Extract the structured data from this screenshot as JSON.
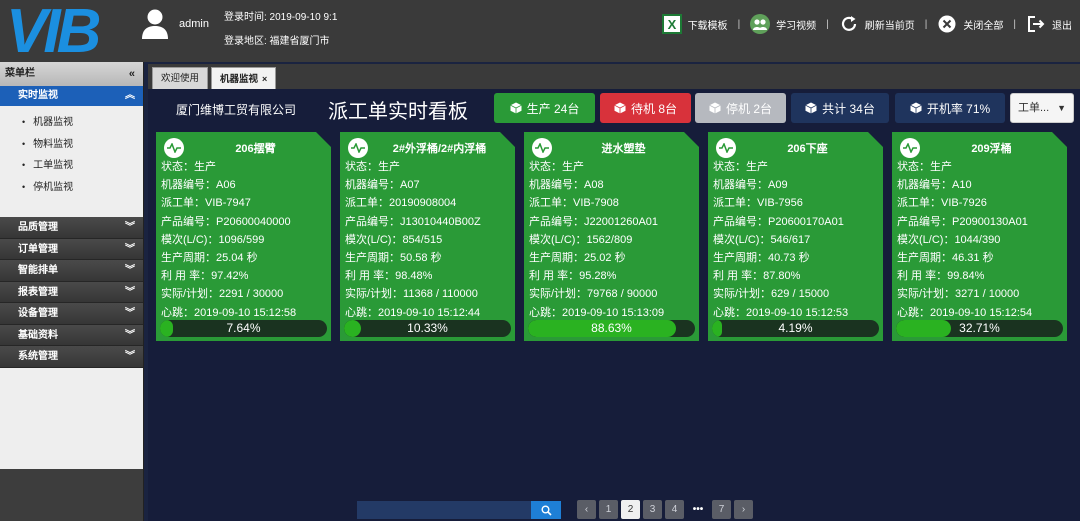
{
  "header": {
    "logo_text": "VIB",
    "username": "admin",
    "login_time": "登录时间: 2019-09-10 9:1",
    "login_region": "登录地区: 福建省厦门市",
    "tools": [
      {
        "label": "下载模板",
        "icon": "excel-icon"
      },
      {
        "label": "学习视频",
        "icon": "users-icon"
      },
      {
        "label": "刷新当前页",
        "icon": "refresh-icon"
      },
      {
        "label": "关闭全部",
        "icon": "close-circle-icon"
      },
      {
        "label": "退出",
        "icon": "logout-icon"
      }
    ]
  },
  "sidebar": {
    "title": "菜单栏",
    "active_group": "实时监视",
    "sub_items": [
      "机器监视",
      "物料监视",
      "工单监视",
      "停机监视"
    ],
    "groups": [
      "品质管理",
      "订单管理",
      "智能排单",
      "报表管理",
      "设备管理",
      "基础资料",
      "系统管理"
    ]
  },
  "tabs": [
    {
      "label": "欢迎使用",
      "active": false
    },
    {
      "label": "机器监视",
      "active": true
    }
  ],
  "board": {
    "company": "厦门维博工贸有限公司",
    "title": "派工单实时看板",
    "stats": {
      "production": "生产 24台",
      "waiting": "待机 8台",
      "stopped": "停机 2台",
      "total": "共计 34台",
      "rate": "开机率 71%"
    },
    "select_value": "工单..."
  },
  "cards": [
    {
      "title": "206摆臂",
      "status": "状态：生产",
      "machine": "机器编号：A06",
      "order": "派工单：VIB-7947",
      "product": "产品编号：P20600040000",
      "mold": "模次(L/C)：1096/599",
      "cycle": "生产周期：25.04 秒",
      "util": "利 用 率：97.42%",
      "plan": "实际/计划：2291 / 30000",
      "heartbeat": "心跳：2019-09-10 15:12:58",
      "progress": 7.64,
      "progress_label": "7.64%"
    },
    {
      "title": "2#外浮桶/2#内浮桶",
      "status": "状态：生产",
      "machine": "机器编号：A07",
      "order": "派工单：20190908004",
      "product": "产品编号：J13010440B00Z",
      "mold": "模次(L/C)：854/515",
      "cycle": "生产周期：50.58 秒",
      "util": "利 用 率：98.48%",
      "plan": "实际/计划：11368 / 110000",
      "heartbeat": "心跳：2019-09-10 15:12:44",
      "progress": 10.33,
      "progress_label": "10.33%"
    },
    {
      "title": "进水塑垫",
      "status": "状态：生产",
      "machine": "机器编号：A08",
      "order": "派工单：VIB-7908",
      "product": "产品编号：J22001260A01",
      "mold": "模次(L/C)：1562/809",
      "cycle": "生产周期：25.02 秒",
      "util": "利 用 率：95.28%",
      "plan": "实际/计划：79768 / 90000",
      "heartbeat": "心跳：2019-09-10 15:13:09",
      "progress": 88.63,
      "progress_label": "88.63%"
    },
    {
      "title": "206下座",
      "status": "状态：生产",
      "machine": "机器编号：A09",
      "order": "派工单：VIB-7956",
      "product": "产品编号：P20600170A01",
      "mold": "模次(L/C)：546/617",
      "cycle": "生产周期：40.73 秒",
      "util": "利 用 率：87.80%",
      "plan": "实际/计划：629 / 15000",
      "heartbeat": "心跳：2019-09-10 15:12:53",
      "progress": 4.19,
      "progress_label": "4.19%"
    },
    {
      "title": "209浮桶",
      "status": "状态：生产",
      "machine": "机器编号：A10",
      "order": "派工单：VIB-7926",
      "product": "产品编号：P20900130A01",
      "mold": "模次(L/C)：1044/390",
      "cycle": "生产周期：46.31 秒",
      "util": "利 用 率：99.84%",
      "plan": "实际/计划：3271 / 10000",
      "heartbeat": "心跳：2019-09-10 15:12:54",
      "progress": 32.71,
      "progress_label": "32.71%"
    }
  ],
  "pager": {
    "search_value": "",
    "pages": [
      "1",
      "2",
      "3",
      "4",
      "•••",
      "7"
    ],
    "current": "2"
  },
  "colors": {
    "card_green": "#2a9a37",
    "progress_fill": "#2ab221",
    "waiting_red": "#d8323b",
    "active_blue": "#1c60b8",
    "board_bg": "#161d3a"
  }
}
